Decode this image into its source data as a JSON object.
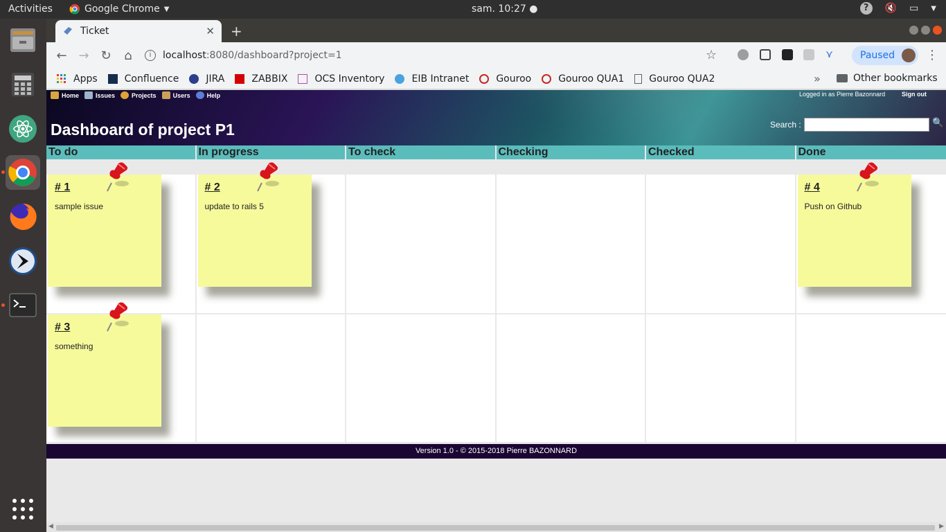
{
  "topbar": {
    "activities": "Activities",
    "app_name": "Google Chrome",
    "clock": "sam. 10:27"
  },
  "browser": {
    "tab_title": "Ticket",
    "url_host": "localhost",
    "url_path": ":8080/dashboard?project=1",
    "profile_status": "Paused",
    "bookmarks": [
      {
        "label": "Apps",
        "icon": "apps-grid-icon",
        "color": "#e53935"
      },
      {
        "label": "Confluence",
        "icon": "confluence-icon",
        "color": "#172b4d"
      },
      {
        "label": "JIRA",
        "icon": "jira-icon",
        "color": "#2b3f8c"
      },
      {
        "label": "ZABBIX",
        "icon": "zabbix-icon",
        "color": "#d40000"
      },
      {
        "label": "OCS Inventory",
        "icon": "ocs-icon",
        "color": "#b04fa8"
      },
      {
        "label": "EIB Intranet",
        "icon": "globe-icon",
        "color": "#4aa3df"
      },
      {
        "label": "Gouroo",
        "icon": "gouroo-icon",
        "color": "#c62828"
      },
      {
        "label": "Gouroo QUA1",
        "icon": "gouroo-icon",
        "color": "#c62828"
      },
      {
        "label": "Gouroo QUA2",
        "icon": "page-icon",
        "color": "#5f6368"
      }
    ],
    "more_bookmarks": "»",
    "other_bookmarks": "Other bookmarks"
  },
  "app": {
    "menu": [
      {
        "label": "Home",
        "icon": "home-icon",
        "color": "#d9a441"
      },
      {
        "label": "Issues",
        "icon": "issues-icon",
        "color": "#9fb4cc"
      },
      {
        "label": "Projects",
        "icon": "projects-icon",
        "color": "#e0a03a"
      },
      {
        "label": "Users",
        "icon": "users-icon",
        "color": "#c8a05a"
      },
      {
        "label": "Help",
        "icon": "help-icon",
        "color": "#5b7fd6"
      }
    ],
    "logged_in": "Logged in as Pierre Bazonnard",
    "sign_out": "Sign out",
    "title": "Dashboard of project P1",
    "search_label": "Search :",
    "columns": [
      "To do",
      "In progress",
      "To check",
      "Checking",
      "Checked",
      "Done"
    ],
    "tickets": [
      {
        "number": "# 1",
        "summary": "sample issue",
        "column": 0,
        "row": 0
      },
      {
        "number": "# 2",
        "summary": "update to rails 5",
        "column": 1,
        "row": 0
      },
      {
        "number": "# 4",
        "summary": "Push on Github",
        "column": 5,
        "row": 0
      },
      {
        "number": "# 3",
        "summary": "something",
        "column": 0,
        "row": 1
      }
    ],
    "footer": "Version 1.0 - © 2015-2018 Pierre BAZONNARD"
  },
  "colors": {
    "column_header": "#5bbcbc",
    "note": "#f6fa9b",
    "footer": "#1a0533",
    "ubuntu_accent": "#e95420"
  }
}
